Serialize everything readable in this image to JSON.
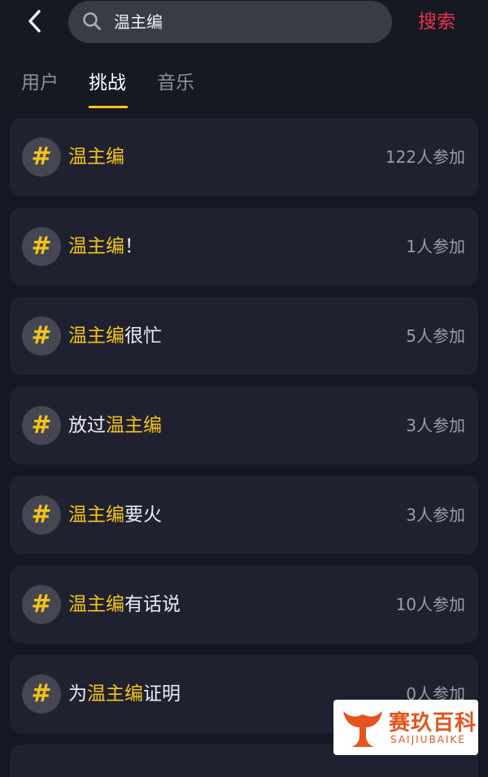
{
  "header": {
    "search_query": "温主编",
    "search_button": "搜索"
  },
  "tabs": [
    {
      "label": "用户",
      "active": false
    },
    {
      "label": "挑战",
      "active": true
    },
    {
      "label": "音乐",
      "active": false
    }
  ],
  "accent_color": "#f5c518",
  "search_button_color": "#e8334f",
  "challenges": [
    {
      "pre": "",
      "highlight": "温主编",
      "post": "",
      "count": "122人参加"
    },
    {
      "pre": "",
      "highlight": "温主编",
      "post": "！",
      "count": "1人参加"
    },
    {
      "pre": "",
      "highlight": "温主编",
      "post": "很忙",
      "count": "5人参加"
    },
    {
      "pre": "放过",
      "highlight": "温主编",
      "post": "",
      "count": "3人参加"
    },
    {
      "pre": "",
      "highlight": "温主编",
      "post": "要火",
      "count": "3人参加"
    },
    {
      "pre": "",
      "highlight": "温主编",
      "post": "有话说",
      "count": "10人参加"
    },
    {
      "pre": "为",
      "highlight": "温主编",
      "post": "证明",
      "count": "0人参加"
    }
  ],
  "hash_symbol": "#",
  "watermark": {
    "cn": "赛玖百科",
    "en": "SAIJIUBAIKE"
  }
}
